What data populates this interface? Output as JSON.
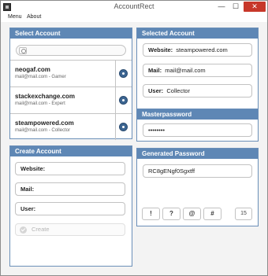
{
  "window": {
    "title": "AccountRect",
    "minimize_glyph": "—",
    "maximize_glyph": "☐",
    "close_glyph": "✕"
  },
  "menu": {
    "items": [
      "Menu",
      "About"
    ]
  },
  "select_account": {
    "header": "Select Account",
    "search_placeholder": "",
    "accounts": [
      {
        "name": "neogaf.com",
        "detail": "mail@mail.com - Gamer"
      },
      {
        "name": "stackexchange.com",
        "detail": "mail@mail.com - Expert"
      },
      {
        "name": "steampowered.com",
        "detail": "mail@mail.com - Collector"
      }
    ]
  },
  "create_account": {
    "header": "Create Account",
    "website_label": "Website:",
    "mail_label": "Mail:",
    "user_label": "User:",
    "create_label": "Create"
  },
  "selected_account": {
    "header": "Selected Account",
    "website_label": "Website:",
    "website_value": "steampowered.com",
    "mail_label": "Mail:",
    "mail_value": "mail@mail.com",
    "user_label": "User:",
    "user_value": "Collector"
  },
  "masterpassword": {
    "header": "Masterpassword",
    "value": "••••••••"
  },
  "generated_password": {
    "header": "Generated Password",
    "value": "RC8gENgf0Sgxtff",
    "symbols": [
      "!",
      "?",
      "@",
      "#"
    ],
    "length": "15"
  },
  "colors": {
    "header": "#5e87b5",
    "accent_button": "#3c6591",
    "close_button": "#c7372a"
  },
  "icons": {
    "search": "search-icon",
    "account_action": "arrow-circle-icon",
    "create": "check-circle-icon",
    "app": "app-icon"
  }
}
